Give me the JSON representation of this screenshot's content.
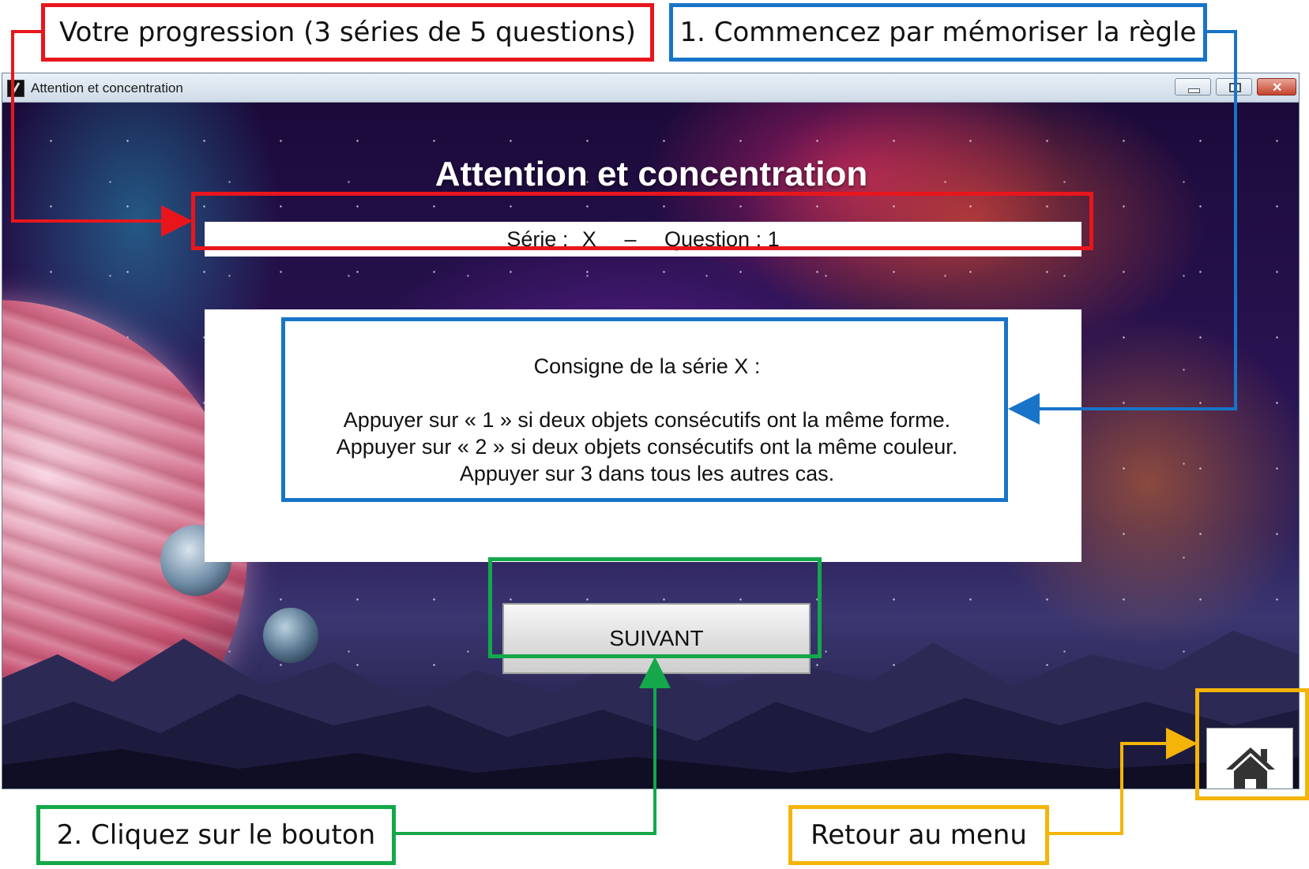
{
  "window": {
    "title": "Attention et concentration"
  },
  "app": {
    "title": "Attention et concentration",
    "progress": {
      "serie_label": "Série :",
      "serie_value": "X",
      "separator": "–",
      "question_label": "Question :",
      "question_value": "1"
    },
    "instructions": {
      "heading": "Consigne de la série X :",
      "lines": [
        "Appuyer sur « 1 » si deux objets consécutifs ont la même forme.",
        "Appuyer sur « 2 » si deux objets consécutifs ont la même couleur.",
        "Appuyer sur 3 dans tous les autres cas."
      ]
    },
    "next_button_label": "SUIVANT",
    "home_icon": "home-icon"
  },
  "annotations": {
    "progress_note": "Votre progression (3 séries de 5 questions)",
    "rule_note": "1. Commencez par mémoriser la règle",
    "button_note": "2. Cliquez sur le bouton",
    "menu_note": "Retour au menu"
  },
  "colors": {
    "red": "#e8161c",
    "blue": "#1874c8",
    "green": "#14a84a",
    "yellow": "#f4b40a"
  }
}
